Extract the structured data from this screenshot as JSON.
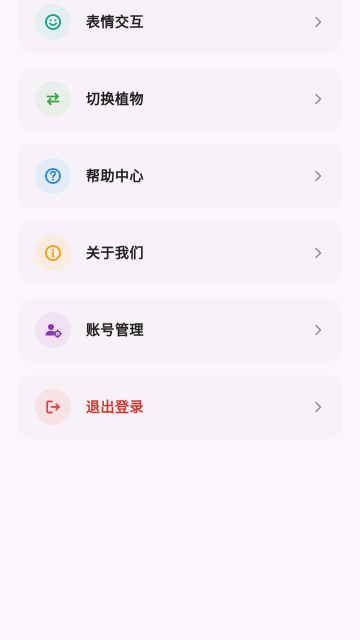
{
  "menu": {
    "items": [
      {
        "label": "表情交互",
        "icon": "smiley-icon",
        "icon_color": "#199e88",
        "icon_bg": "#e3eff0",
        "label_color": "#222222"
      },
      {
        "label": "切换植物",
        "icon": "swap-arrows-icon",
        "icon_color": "#3ca24a",
        "icon_bg": "#e8eee8",
        "label_color": "#222222"
      },
      {
        "label": "帮助中心",
        "icon": "help-circle-icon",
        "icon_color": "#2d86e0",
        "icon_bg": "#e2ecf7",
        "label_color": "#222222"
      },
      {
        "label": "关于我们",
        "icon": "info-circle-icon",
        "icon_color": "#f39c12",
        "icon_bg": "#f9ecdf",
        "label_color": "#222222"
      },
      {
        "label": "账号管理",
        "icon": "account-settings-icon",
        "icon_color": "#8e34b6",
        "icon_bg": "#f0e2f3",
        "label_color": "#222222"
      },
      {
        "label": "退出登录",
        "icon": "logout-icon",
        "icon_color": "#e04040",
        "icon_bg": "#f9e2e6",
        "label_color": "#d03a30"
      }
    ]
  },
  "colors": {
    "page_bg": "#fbf6fb",
    "card_bg": "#f7f2f7",
    "chevron": "#888888"
  }
}
